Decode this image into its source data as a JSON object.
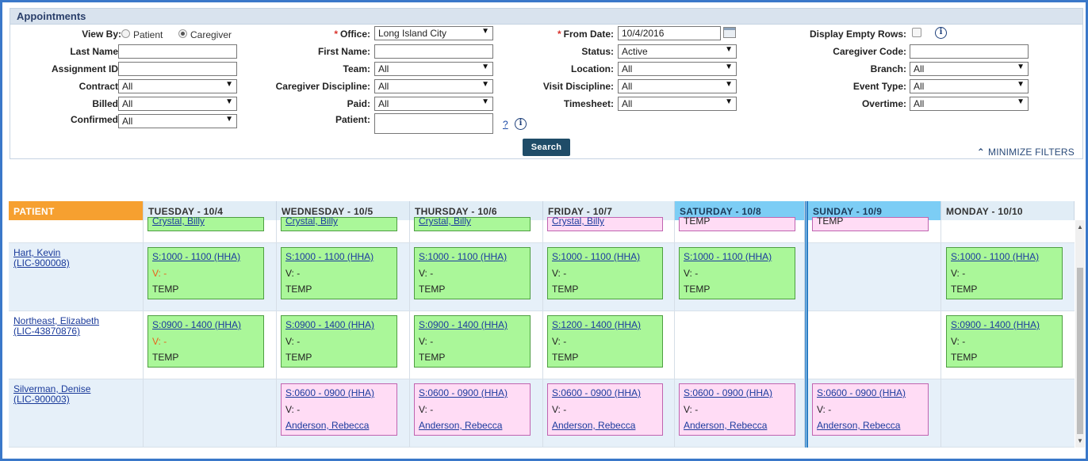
{
  "panel": {
    "title": "Appointments"
  },
  "filters": {
    "view_by_label": "View By:",
    "view_by_opt1": "Patient",
    "view_by_opt2": "Caregiver",
    "last_name_label": "Last Name:",
    "assignment_id_label": "Assignment ID:",
    "contract_label": "Contract:",
    "contract_value": "All",
    "billed_label": "Billed:",
    "billed_value": "All",
    "confirmed_label": "Confirmed:",
    "confirmed_value": "All",
    "office_label": "Office:",
    "office_value": "Long Island City",
    "first_name_label": "First Name:",
    "team_label": "Team:",
    "team_value": "All",
    "caregiver_discipline_label": "Caregiver Discipline:",
    "caregiver_discipline_value": "All",
    "paid_label": "Paid:",
    "paid_value": "All",
    "patient_label": "Patient:",
    "patient_help": "?",
    "from_date_label": "From Date:",
    "from_date_value": "10/4/2016",
    "status_label": "Status:",
    "status_value": "Active",
    "location_label": "Location:",
    "location_value": "All",
    "visit_discipline_label": "Visit Discipline:",
    "visit_discipline_value": "All",
    "timesheet_label": "Timesheet:",
    "timesheet_value": "All",
    "display_empty_rows_label": "Display Empty Rows:",
    "caregiver_code_label": "Caregiver Code:",
    "branch_label": "Branch:",
    "branch_value": "All",
    "event_type_label": "Event Type:",
    "event_type_value": "All",
    "overtime_label": "Overtime:",
    "overtime_value": "All",
    "required_mark": "*",
    "info_glyph": "i",
    "dropdown_arrow": "▼"
  },
  "search_button": "Search",
  "minimize_filters": "MINIMIZE FILTERS",
  "grid": {
    "headers": [
      "PATIENT",
      "TUESDAY - 10/4",
      "WEDNESDAY - 10/5",
      "THURSDAY - 10/6",
      "FRIDAY - 10/7",
      "SATURDAY - 10/8",
      "SUNDAY - 10/9",
      "MONDAY - 10/10"
    ],
    "partial_row": {
      "tue": "Crystal, Billy",
      "wed": "Crystal, Billy",
      "thu": "Crystal, Billy",
      "fri": "Crystal, Billy",
      "sat": "TEMP",
      "sun": "TEMP"
    },
    "rows": [
      {
        "patient_name": "Hart, Kevin",
        "patient_id": "(LIC-900008)",
        "tue": {
          "time": "S:1000 - 1100 (HHA)",
          "visit": "V: -",
          "who": "TEMP"
        },
        "wed": {
          "time": "S:1000 - 1100 (HHA)",
          "visit": "V: -",
          "who": "TEMP"
        },
        "thu": {
          "time": "S:1000 - 1100 (HHA)",
          "visit": "V: -",
          "who": "TEMP"
        },
        "fri": {
          "time": "S:1000 - 1100 (HHA)",
          "visit": "V: -",
          "who": "TEMP"
        },
        "sat": {
          "time": "S:1000 - 1100 (HHA)",
          "visit": "V: -",
          "who": "TEMP"
        },
        "mon": {
          "time": "S:1000 - 1100 (HHA)",
          "visit": "V: -",
          "who": "TEMP"
        }
      },
      {
        "patient_name": "Northeast, Elizabeth",
        "patient_id": "(LIC-43870876)",
        "tue": {
          "time": "S:0900 - 1400 (HHA)",
          "visit": "V: -",
          "who": "TEMP"
        },
        "wed": {
          "time": "S:0900 - 1400 (HHA)",
          "visit": "V: -",
          "who": "TEMP"
        },
        "thu": {
          "time": "S:0900 - 1400 (HHA)",
          "visit": "V: -",
          "who": "TEMP"
        },
        "fri": {
          "time": "S:1200 - 1400 (HHA)",
          "visit": "V: -",
          "who": "TEMP"
        },
        "mon": {
          "time": "S:0900 - 1400 (HHA)",
          "visit": "V: -",
          "who": "TEMP"
        }
      },
      {
        "patient_name": "Silverman, Denise",
        "patient_id": "(LIC-900003)",
        "wed": {
          "time": "S:0600 - 0900 (HHA)",
          "visit": "V: -",
          "who": "Anderson, Rebecca"
        },
        "thu": {
          "time": "S:0600 - 0900 (HHA)",
          "visit": "V: -",
          "who": "Anderson, Rebecca"
        },
        "fri": {
          "time": "S:0600 - 0900 (HHA)",
          "visit": "V: -",
          "who": "Anderson, Rebecca"
        },
        "sat": {
          "time": "S:0600 - 0900 (HHA)",
          "visit": "V: -",
          "who": "Anderson, Rebecca"
        },
        "sun": {
          "time": "S:0600 - 0900 (HHA)",
          "visit": "V: -",
          "who": "Anderson, Rebecca"
        }
      }
    ]
  },
  "colors": {
    "accent_blue": "#3a78c9",
    "patient_header": "#f6a030",
    "weekend_header": "#7ccdf5",
    "green_card": "#aaf799",
    "pink_card": "#ffdcf5",
    "search_button": "#1f4c68"
  },
  "icons": {
    "calendar": "calendar-icon",
    "info": "info-icon",
    "minimize": "double-chevron-up-icon",
    "scroll_up": "scroll-up-arrow-icon",
    "scroll_down": "scroll-down-arrow-icon"
  },
  "scroll_up_glyph": "▲",
  "scroll_down_glyph": "▼",
  "minimize_glyph": "⌃"
}
